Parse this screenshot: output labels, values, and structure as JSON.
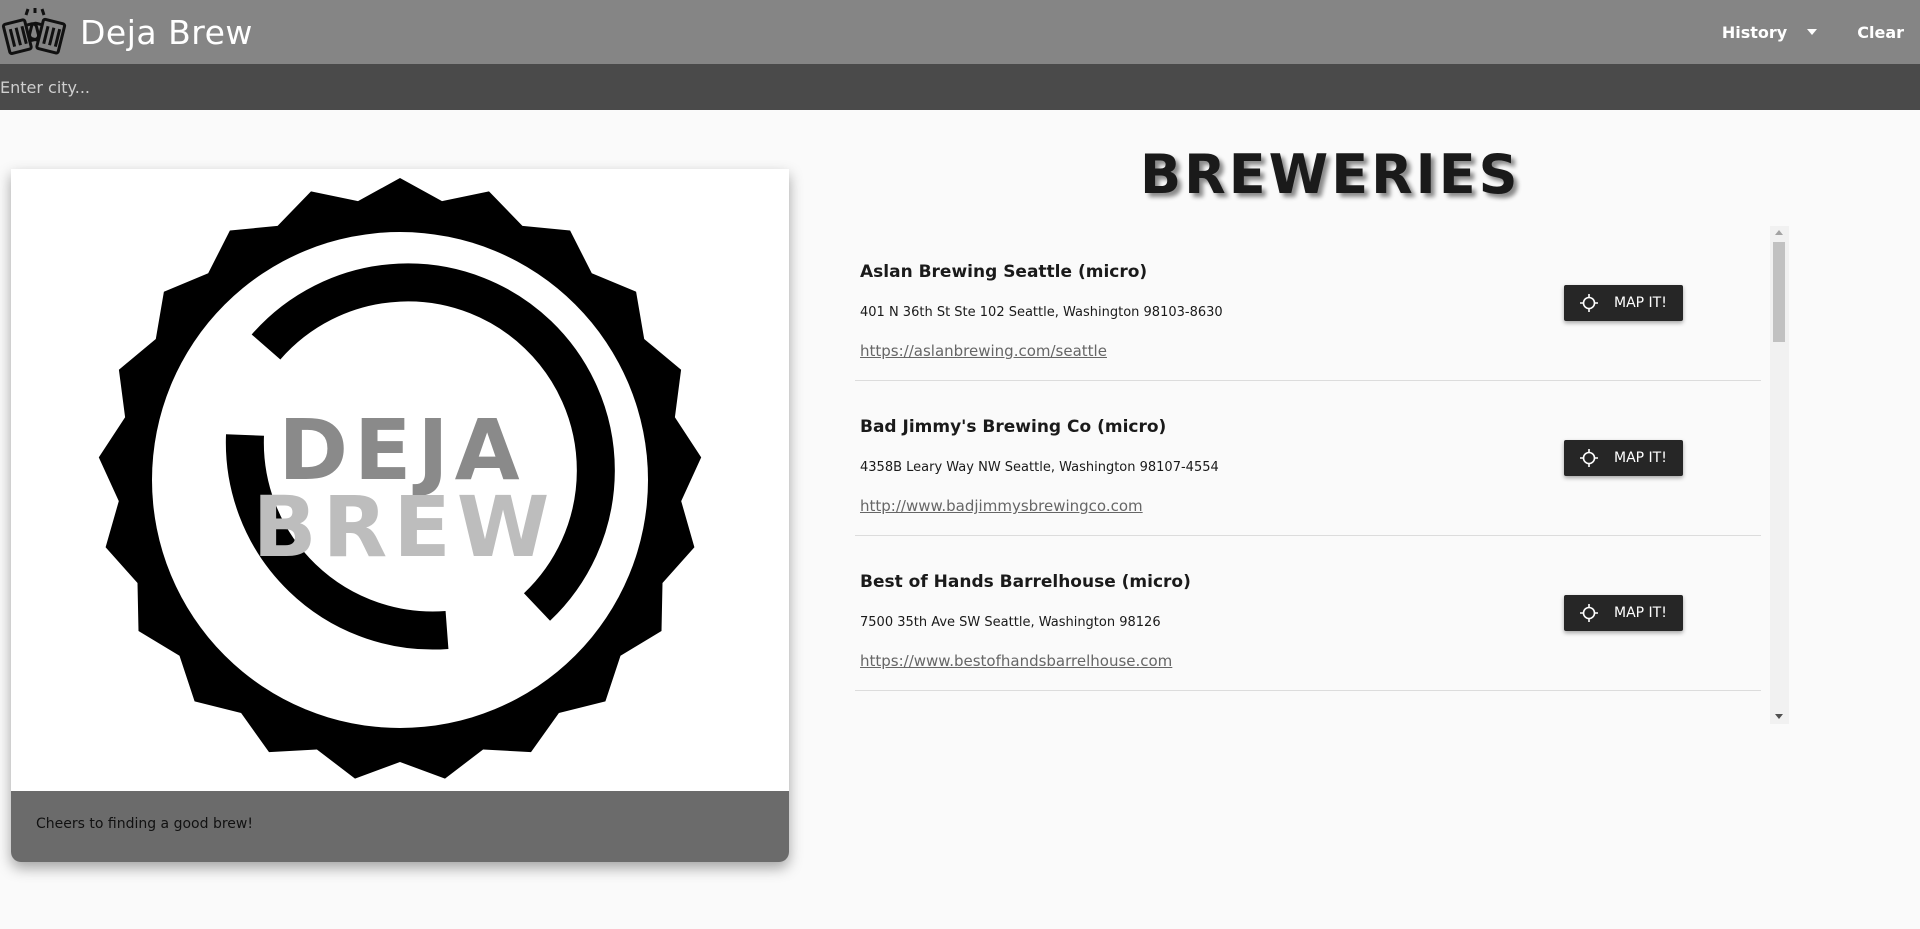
{
  "app": {
    "title": "Deja Brew",
    "logo_icon": "cheers-mugs-icon"
  },
  "nav": {
    "history_label": "History",
    "clear_label": "Clear"
  },
  "search": {
    "placeholder": "Enter city...",
    "value": ""
  },
  "card": {
    "logo_text_top": "DEJA",
    "logo_text_bottom": "BREW",
    "caption": "Cheers to finding a good brew!"
  },
  "breweries": {
    "heading": "BREWERIES",
    "map_button_label": "MAP IT!",
    "items": [
      {
        "name": "Aslan Brewing Seattle (micro)",
        "address": "401 N 36th St Ste 102 Seattle, Washington 98103-8630",
        "url": "https://aslanbrewing.com/seattle"
      },
      {
        "name": "Bad Jimmy's Brewing Co (micro)",
        "address": "4358B Leary Way NW Seattle, Washington 98107-4554",
        "url": "http://www.badjimmysbrewingco.com"
      },
      {
        "name": "Best of Hands Barrelhouse (micro)",
        "address": "7500 35th Ave SW Seattle, Washington 98126",
        "url": "https://www.bestofhandsbarrelhouse.com"
      }
    ]
  },
  "colors": {
    "navbar": "#858585",
    "searchbar": "#4a4a4a",
    "card_footer": "#6b6b6b",
    "button": "#262626",
    "background": "#fafafa"
  }
}
